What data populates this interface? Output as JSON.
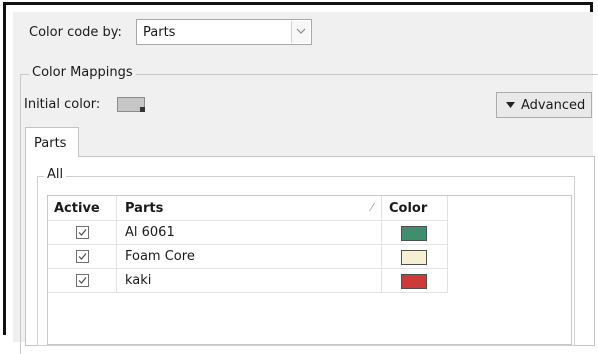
{
  "header": {
    "color_code_label": "Color code by:",
    "color_code_value": "Parts"
  },
  "mappings": {
    "group_title": "Color Mappings",
    "initial_color_label": "Initial color:",
    "initial_color": "#c6c6c6",
    "advanced_label": "Advanced"
  },
  "tabs": [
    {
      "label": "Parts",
      "selected": true
    }
  ],
  "all_group": {
    "title": "All"
  },
  "table": {
    "columns": [
      "Active",
      "Parts",
      "Color"
    ],
    "rows": [
      {
        "active": true,
        "part": "Al 6061",
        "color": "#3e8f6e"
      },
      {
        "active": true,
        "part": "Foam Core",
        "color": "#f5f0d2"
      },
      {
        "active": true,
        "part": "kaki",
        "color": "#cc3a3a"
      }
    ]
  }
}
